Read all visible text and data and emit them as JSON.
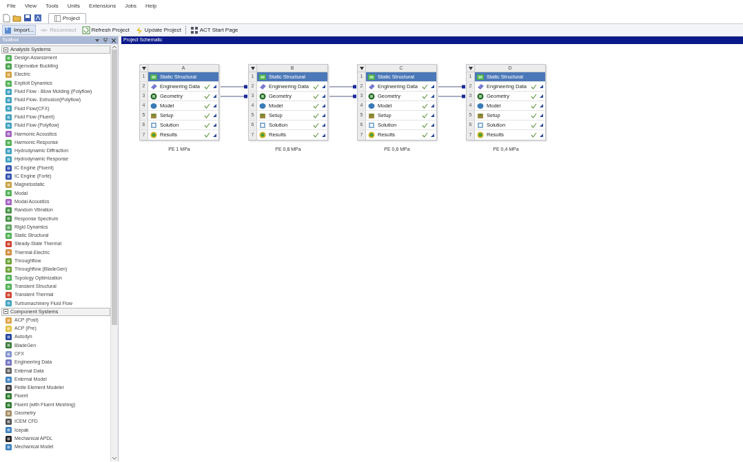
{
  "menu": [
    "File",
    "View",
    "Tools",
    "Units",
    "Extensions",
    "Jobs",
    "Help"
  ],
  "tabs": [
    {
      "label": "Project",
      "selected": true
    }
  ],
  "toolbar": [
    {
      "label": "Import...",
      "kind": "import",
      "disabled": false
    },
    {
      "label": "Reconnect",
      "kind": "reconnect",
      "disabled": true
    },
    {
      "label": "Refresh Project",
      "kind": "refresh",
      "disabled": false
    },
    {
      "label": "Update Project",
      "kind": "update",
      "disabled": false
    },
    {
      "label": "ACT Start Page",
      "kind": "act",
      "disabled": false
    }
  ],
  "toolbox": {
    "title": "Toolbox",
    "groups": [
      {
        "label": "Analysis Systems",
        "expanded": true,
        "items": [
          {
            "label": "Design Assessment",
            "color": "#4caf50"
          },
          {
            "label": "Eigenvalue Buckling",
            "color": "#43a047"
          },
          {
            "label": "Electric",
            "color": "#d4a03a"
          },
          {
            "label": "Explicit Dynamics",
            "color": "#4caf50"
          },
          {
            "label": "Fluid Flow - Blow Molding (Polyflow)",
            "color": "#3a9fbf"
          },
          {
            "label": "Fluid Flow- Extrusion(Polyflow)",
            "color": "#3a9fbf"
          },
          {
            "label": "Fluid Flow(CFX)",
            "color": "#3a9fbf"
          },
          {
            "label": "Fluid Flow (Fluent)",
            "color": "#3a9fbf"
          },
          {
            "label": "Fluid Flow (Polyflow)",
            "color": "#3a9fbf"
          },
          {
            "label": "Harmonic Acoustics",
            "color": "#a05fc0"
          },
          {
            "label": "Harmonic Response",
            "color": "#4caf50"
          },
          {
            "label": "Hydrodynamic Diffraction",
            "color": "#3a9fbf"
          },
          {
            "label": "Hydrodynamic Response",
            "color": "#3a9fbf"
          },
          {
            "label": "IC Engine (Fluent)",
            "color": "#3050b0"
          },
          {
            "label": "IC Engine (Forte)",
            "color": "#3050b0"
          },
          {
            "label": "Magnetostatic",
            "color": "#c8a040"
          },
          {
            "label": "Modal",
            "color": "#4caf50"
          },
          {
            "label": "Modal Acoustics",
            "color": "#a05fc0"
          },
          {
            "label": "Random Vibration",
            "color": "#3f8f3f"
          },
          {
            "label": "Response Spectrum",
            "color": "#3f8f3f"
          },
          {
            "label": "Rigid Dynamics",
            "color": "#5aa05a"
          },
          {
            "label": "Static Structural",
            "color": "#4caf50"
          },
          {
            "label": "Steady-State Thermal",
            "color": "#d0402a"
          },
          {
            "label": "Thermal-Electric",
            "color": "#d08a3a"
          },
          {
            "label": "Throughflow",
            "color": "#6aa030"
          },
          {
            "label": "Throughflow (BladeGen)",
            "color": "#6aa030"
          },
          {
            "label": "Topology Optimization",
            "color": "#4caf50"
          },
          {
            "label": "Transient Structural",
            "color": "#4caf50"
          },
          {
            "label": "Transient Thermal",
            "color": "#d0402a"
          },
          {
            "label": "Turbomachinery Fluid Flow",
            "color": "#3a9fbf"
          }
        ]
      },
      {
        "label": "Component Systems",
        "expanded": true,
        "items": [
          {
            "label": "ACP (Post)",
            "color": "#e0a040"
          },
          {
            "label": "ACP (Pre)",
            "color": "#e0c040"
          },
          {
            "label": "Autodyn",
            "color": "#2040a0"
          },
          {
            "label": "BladeGen",
            "color": "#3a7a3a"
          },
          {
            "label": "CFX",
            "color": "#8090d0"
          },
          {
            "label": "Engineering Data",
            "color": "#7070c0"
          },
          {
            "label": "External Data",
            "color": "#606060"
          },
          {
            "label": "External Model",
            "color": "#3a80c0"
          },
          {
            "label": "Finite Element Modeler",
            "color": "#404040"
          },
          {
            "label": "Fluent",
            "color": "#2a7a2a"
          },
          {
            "label": "Fluent (with Fluent Meshing)",
            "color": "#2a7a2a"
          },
          {
            "label": "Geometry",
            "color": "#a08a60"
          },
          {
            "label": "ICEM CFD",
            "color": "#505050"
          },
          {
            "label": "Icepak",
            "color": "#3a80c0"
          },
          {
            "label": "Mechanical APDL",
            "color": "#202020"
          },
          {
            "label": "Mechanical Model",
            "color": "#3a80c0"
          }
        ]
      }
    ]
  },
  "schematic": {
    "title": "Project Schematic",
    "systems": [
      {
        "column": "A",
        "caption": "PE 1 MPa",
        "cells": [
          {
            "num": "1",
            "label": "Static Structural",
            "kind": "title",
            "linked": false,
            "up_to_date": false
          },
          {
            "num": "2",
            "label": "Engineering Data",
            "kind": "engdata",
            "linked": false,
            "up_to_date": true
          },
          {
            "num": "3",
            "label": "Geometry",
            "kind": "geometry",
            "linked": false,
            "up_to_date": true
          },
          {
            "num": "4",
            "label": "Model",
            "kind": "model",
            "linked": false,
            "up_to_date": true
          },
          {
            "num": "5",
            "label": "Setup",
            "kind": "setup",
            "linked": false,
            "up_to_date": true
          },
          {
            "num": "6",
            "label": "Solution",
            "kind": "solution",
            "linked": false,
            "up_to_date": true
          },
          {
            "num": "7",
            "label": "Results",
            "kind": "results",
            "linked": false,
            "up_to_date": true
          }
        ]
      },
      {
        "column": "B",
        "caption": "PE 0,8 MPa",
        "cells": [
          {
            "num": "1",
            "label": "Static Structural",
            "kind": "title",
            "linked": false,
            "up_to_date": false
          },
          {
            "num": "2",
            "label": "Engineering Data",
            "kind": "engdata",
            "linked": true,
            "up_to_date": true
          },
          {
            "num": "3",
            "label": "Geometry",
            "kind": "geometry",
            "linked": true,
            "up_to_date": true
          },
          {
            "num": "4",
            "label": "Model",
            "kind": "model",
            "linked": false,
            "up_to_date": true
          },
          {
            "num": "5",
            "label": "Setup",
            "kind": "setup",
            "linked": false,
            "up_to_date": true
          },
          {
            "num": "6",
            "label": "Solution",
            "kind": "solution",
            "linked": false,
            "up_to_date": true
          },
          {
            "num": "7",
            "label": "Results",
            "kind": "results",
            "linked": false,
            "up_to_date": true
          }
        ]
      },
      {
        "column": "C",
        "caption": "PE 0,6 MPa",
        "cells": [
          {
            "num": "1",
            "label": "Static Structural",
            "kind": "title",
            "linked": false,
            "up_to_date": false
          },
          {
            "num": "2",
            "label": "Engineering Data",
            "kind": "engdata",
            "linked": true,
            "up_to_date": true
          },
          {
            "num": "3",
            "label": "Geometry",
            "kind": "geometry",
            "linked": true,
            "up_to_date": true
          },
          {
            "num": "4",
            "label": "Model",
            "kind": "model",
            "linked": false,
            "up_to_date": true
          },
          {
            "num": "5",
            "label": "Setup",
            "kind": "setup",
            "linked": false,
            "up_to_date": true
          },
          {
            "num": "6",
            "label": "Solution",
            "kind": "solution",
            "linked": false,
            "up_to_date": true
          },
          {
            "num": "7",
            "label": "Results",
            "kind": "results",
            "linked": false,
            "up_to_date": true
          }
        ]
      },
      {
        "column": "D",
        "caption": "PE 0,4 MPa",
        "cells": [
          {
            "num": "1",
            "label": "Static Structural",
            "kind": "title",
            "linked": false,
            "up_to_date": false
          },
          {
            "num": "2",
            "label": "Engineering Data",
            "kind": "engdata",
            "linked": true,
            "up_to_date": true
          },
          {
            "num": "3",
            "label": "Geometry",
            "kind": "geometry",
            "linked": true,
            "up_to_date": true
          },
          {
            "num": "4",
            "label": "Model",
            "kind": "model",
            "linked": false,
            "up_to_date": true
          },
          {
            "num": "5",
            "label": "Setup",
            "kind": "setup",
            "linked": false,
            "up_to_date": true
          },
          {
            "num": "6",
            "label": "Solution",
            "kind": "solution",
            "linked": false,
            "up_to_date": true
          },
          {
            "num": "7",
            "label": "Results",
            "kind": "results",
            "linked": false,
            "up_to_date": true
          }
        ]
      }
    ]
  }
}
